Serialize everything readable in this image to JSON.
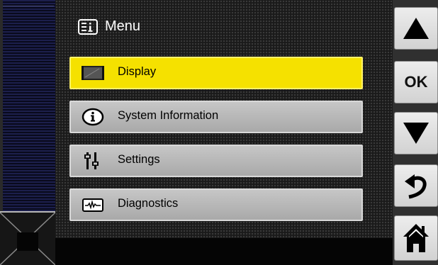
{
  "header": {
    "title": "Menu",
    "icon": "menu-list-icon"
  },
  "menu": {
    "items": [
      {
        "label": "Display",
        "icon": "display-icon",
        "active": true
      },
      {
        "label": "System Information",
        "icon": "info-icon",
        "active": false
      },
      {
        "label": "Settings",
        "icon": "settings-sliders-icon",
        "active": false
      },
      {
        "label": "Diagnostics",
        "icon": "diagnostics-wave-icon",
        "active": false
      }
    ]
  },
  "side_buttons": {
    "up": {
      "icon": "arrow-up-icon"
    },
    "ok": {
      "label": "OK"
    },
    "down": {
      "icon": "arrow-down-icon"
    },
    "back": {
      "icon": "back-arrow-icon"
    },
    "home": {
      "icon": "home-icon"
    }
  },
  "colors": {
    "active_item": "#f5e100",
    "inactive_item": "#b8b8b8",
    "background": "#1a1a1a",
    "strip": "#1c1f4c"
  }
}
